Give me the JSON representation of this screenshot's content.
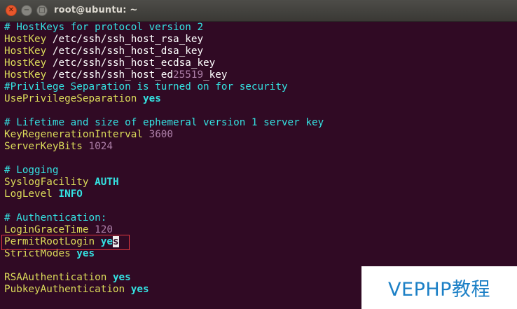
{
  "window": {
    "title": "root@ubuntu: ~",
    "close_glyph": "✕",
    "minimize_glyph": "−",
    "maximize_glyph": "□"
  },
  "terminal": {
    "lines": [
      [
        {
          "t": "# HostKeys for protocol version 2",
          "c": "c"
        }
      ],
      [
        {
          "t": "HostKey",
          "c": "k"
        },
        {
          "t": " /etc/ssh/ssh_host_rsa_key",
          "c": "t"
        }
      ],
      [
        {
          "t": "HostKey",
          "c": "k"
        },
        {
          "t": " /etc/ssh/ssh_host_dsa_key",
          "c": "t"
        }
      ],
      [
        {
          "t": "HostKey",
          "c": "k"
        },
        {
          "t": " /etc/ssh/ssh_host_ecdsa_key",
          "c": "t"
        }
      ],
      [
        {
          "t": "HostKey",
          "c": "k"
        },
        {
          "t": " /etc/ssh/ssh_host_ed",
          "c": "t"
        },
        {
          "t": "25519",
          "c": "v"
        },
        {
          "t": "_key",
          "c": "t"
        }
      ],
      [
        {
          "t": "#Privilege Separation is turned on for security",
          "c": "c"
        }
      ],
      [
        {
          "t": "UsePrivilegeSeparation",
          "c": "k"
        },
        {
          "t": " ",
          "c": "t"
        },
        {
          "t": "yes",
          "c": "b"
        }
      ],
      [],
      [
        {
          "t": "# Lifetime and size of ephemeral version 1 server key",
          "c": "c"
        }
      ],
      [
        {
          "t": "KeyRegenerationInterval",
          "c": "k"
        },
        {
          "t": " ",
          "c": "t"
        },
        {
          "t": "3600",
          "c": "v"
        }
      ],
      [
        {
          "t": "ServerKeyBits",
          "c": "k"
        },
        {
          "t": " ",
          "c": "t"
        },
        {
          "t": "1024",
          "c": "v"
        }
      ],
      [],
      [
        {
          "t": "# Logging",
          "c": "c"
        }
      ],
      [
        {
          "t": "SyslogFacility",
          "c": "k"
        },
        {
          "t": " ",
          "c": "t"
        },
        {
          "t": "AUTH",
          "c": "b"
        }
      ],
      [
        {
          "t": "LogLevel",
          "c": "k"
        },
        {
          "t": " ",
          "c": "t"
        },
        {
          "t": "INFO",
          "c": "b"
        }
      ],
      [],
      [
        {
          "t": "# Authentication:",
          "c": "c"
        }
      ],
      [
        {
          "t": "LoginGraceTime",
          "c": "k"
        },
        {
          "t": " ",
          "c": "t"
        },
        {
          "t": "120",
          "c": "v"
        }
      ],
      [
        {
          "t": "PermitRootLogin",
          "c": "k"
        },
        {
          "t": " ",
          "c": "t"
        },
        {
          "t": "ye",
          "c": "b"
        },
        {
          "t": "s",
          "c": "cursor"
        }
      ],
      [
        {
          "t": "StrictModes",
          "c": "k"
        },
        {
          "t": " ",
          "c": "t"
        },
        {
          "t": "yes",
          "c": "b"
        }
      ],
      [],
      [
        {
          "t": "RSAAuthentication",
          "c": "k"
        },
        {
          "t": " ",
          "c": "t"
        },
        {
          "t": "yes",
          "c": "b"
        }
      ],
      [
        {
          "t": "PubkeyAuthentication",
          "c": "k"
        },
        {
          "t": " ",
          "c": "t"
        },
        {
          "t": "yes",
          "c": "b"
        }
      ]
    ]
  },
  "watermark": {
    "text": "VEPHP教程"
  },
  "colors": {
    "background": "#300a24",
    "keyword": "#dcdc5a",
    "comment": "#34e2e2",
    "number": "#ad7fa8",
    "highlight_box": "#e43a40",
    "watermark_text": "#1c80c6"
  }
}
